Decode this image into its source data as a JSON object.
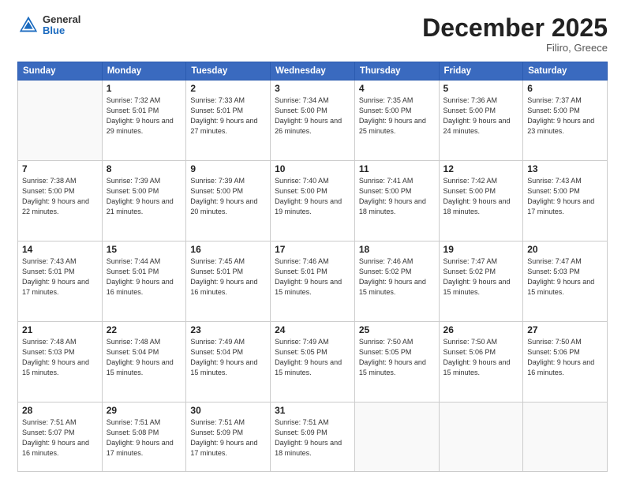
{
  "header": {
    "logo_general": "General",
    "logo_blue": "Blue",
    "month_title": "December 2025",
    "location": "Filiro, Greece"
  },
  "weekdays": [
    "Sunday",
    "Monday",
    "Tuesday",
    "Wednesday",
    "Thursday",
    "Friday",
    "Saturday"
  ],
  "weeks": [
    [
      {
        "day": "",
        "info": ""
      },
      {
        "day": "1",
        "info": "Sunrise: 7:32 AM\nSunset: 5:01 PM\nDaylight: 9 hours\nand 29 minutes."
      },
      {
        "day": "2",
        "info": "Sunrise: 7:33 AM\nSunset: 5:01 PM\nDaylight: 9 hours\nand 27 minutes."
      },
      {
        "day": "3",
        "info": "Sunrise: 7:34 AM\nSunset: 5:00 PM\nDaylight: 9 hours\nand 26 minutes."
      },
      {
        "day": "4",
        "info": "Sunrise: 7:35 AM\nSunset: 5:00 PM\nDaylight: 9 hours\nand 25 minutes."
      },
      {
        "day": "5",
        "info": "Sunrise: 7:36 AM\nSunset: 5:00 PM\nDaylight: 9 hours\nand 24 minutes."
      },
      {
        "day": "6",
        "info": "Sunrise: 7:37 AM\nSunset: 5:00 PM\nDaylight: 9 hours\nand 23 minutes."
      }
    ],
    [
      {
        "day": "7",
        "info": "Sunrise: 7:38 AM\nSunset: 5:00 PM\nDaylight: 9 hours\nand 22 minutes."
      },
      {
        "day": "8",
        "info": "Sunrise: 7:39 AM\nSunset: 5:00 PM\nDaylight: 9 hours\nand 21 minutes."
      },
      {
        "day": "9",
        "info": "Sunrise: 7:39 AM\nSunset: 5:00 PM\nDaylight: 9 hours\nand 20 minutes."
      },
      {
        "day": "10",
        "info": "Sunrise: 7:40 AM\nSunset: 5:00 PM\nDaylight: 9 hours\nand 19 minutes."
      },
      {
        "day": "11",
        "info": "Sunrise: 7:41 AM\nSunset: 5:00 PM\nDaylight: 9 hours\nand 18 minutes."
      },
      {
        "day": "12",
        "info": "Sunrise: 7:42 AM\nSunset: 5:00 PM\nDaylight: 9 hours\nand 18 minutes."
      },
      {
        "day": "13",
        "info": "Sunrise: 7:43 AM\nSunset: 5:00 PM\nDaylight: 9 hours\nand 17 minutes."
      }
    ],
    [
      {
        "day": "14",
        "info": "Sunrise: 7:43 AM\nSunset: 5:01 PM\nDaylight: 9 hours\nand 17 minutes."
      },
      {
        "day": "15",
        "info": "Sunrise: 7:44 AM\nSunset: 5:01 PM\nDaylight: 9 hours\nand 16 minutes."
      },
      {
        "day": "16",
        "info": "Sunrise: 7:45 AM\nSunset: 5:01 PM\nDaylight: 9 hours\nand 16 minutes."
      },
      {
        "day": "17",
        "info": "Sunrise: 7:46 AM\nSunset: 5:01 PM\nDaylight: 9 hours\nand 15 minutes."
      },
      {
        "day": "18",
        "info": "Sunrise: 7:46 AM\nSunset: 5:02 PM\nDaylight: 9 hours\nand 15 minutes."
      },
      {
        "day": "19",
        "info": "Sunrise: 7:47 AM\nSunset: 5:02 PM\nDaylight: 9 hours\nand 15 minutes."
      },
      {
        "day": "20",
        "info": "Sunrise: 7:47 AM\nSunset: 5:03 PM\nDaylight: 9 hours\nand 15 minutes."
      }
    ],
    [
      {
        "day": "21",
        "info": "Sunrise: 7:48 AM\nSunset: 5:03 PM\nDaylight: 9 hours\nand 15 minutes."
      },
      {
        "day": "22",
        "info": "Sunrise: 7:48 AM\nSunset: 5:04 PM\nDaylight: 9 hours\nand 15 minutes."
      },
      {
        "day": "23",
        "info": "Sunrise: 7:49 AM\nSunset: 5:04 PM\nDaylight: 9 hours\nand 15 minutes."
      },
      {
        "day": "24",
        "info": "Sunrise: 7:49 AM\nSunset: 5:05 PM\nDaylight: 9 hours\nand 15 minutes."
      },
      {
        "day": "25",
        "info": "Sunrise: 7:50 AM\nSunset: 5:05 PM\nDaylight: 9 hours\nand 15 minutes."
      },
      {
        "day": "26",
        "info": "Sunrise: 7:50 AM\nSunset: 5:06 PM\nDaylight: 9 hours\nand 15 minutes."
      },
      {
        "day": "27",
        "info": "Sunrise: 7:50 AM\nSunset: 5:06 PM\nDaylight: 9 hours\nand 16 minutes."
      }
    ],
    [
      {
        "day": "28",
        "info": "Sunrise: 7:51 AM\nSunset: 5:07 PM\nDaylight: 9 hours\nand 16 minutes."
      },
      {
        "day": "29",
        "info": "Sunrise: 7:51 AM\nSunset: 5:08 PM\nDaylight: 9 hours\nand 17 minutes."
      },
      {
        "day": "30",
        "info": "Sunrise: 7:51 AM\nSunset: 5:09 PM\nDaylight: 9 hours\nand 17 minutes."
      },
      {
        "day": "31",
        "info": "Sunrise: 7:51 AM\nSunset: 5:09 PM\nDaylight: 9 hours\nand 18 minutes."
      },
      {
        "day": "",
        "info": ""
      },
      {
        "day": "",
        "info": ""
      },
      {
        "day": "",
        "info": ""
      }
    ]
  ]
}
